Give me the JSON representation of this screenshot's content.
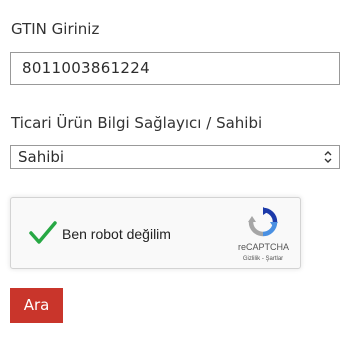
{
  "form": {
    "gtin_label": "GTIN Giriniz",
    "gtin_value": "8011003861224",
    "provider_label": "Ticari Ürün Bilgi Sağlayıcı / Sahibi",
    "provider_selected": "Sahibi",
    "submit_label": "Ara"
  },
  "recaptcha": {
    "checkbox_label": "Ben robot değilim",
    "brand": "reCAPTCHA",
    "privacy_link": "Gizlilik",
    "separator": " - ",
    "terms_link": "Şartlar",
    "checked": true
  },
  "icons": {
    "select_arrows": "updown-chevron-icon",
    "check": "checkmark-icon",
    "logo": "recaptcha-logo-icon"
  },
  "colors": {
    "button_bg": "#c9352b",
    "check_green": "#27a844",
    "recaptcha_blue": "#4a90e2",
    "recaptcha_gray": "#a6a6a6"
  }
}
